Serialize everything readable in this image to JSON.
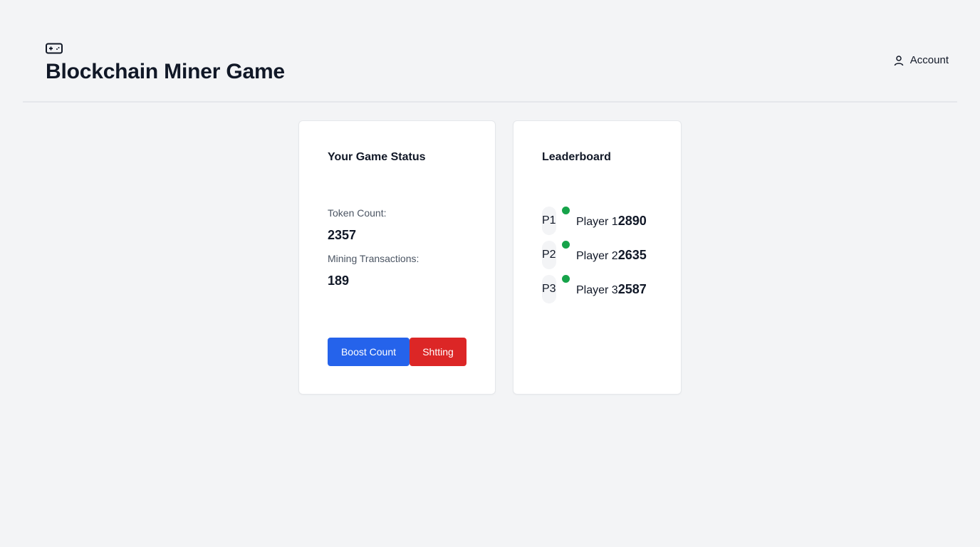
{
  "header": {
    "title": "Blockchain Miner Game",
    "logo_icon": "gamepad-icon",
    "account_label": "Account",
    "account_icon": "user-icon"
  },
  "status_card": {
    "title": "Your Game Status",
    "token_count_label": "Token Count:",
    "token_count_value": "2357",
    "mining_label": "Mining Transactions:",
    "mining_value": "189",
    "boost_button": "Boost Count",
    "shtting_button": "Shtting"
  },
  "leaderboard": {
    "title": "Leaderboard",
    "entries": [
      {
        "avatar": "P1",
        "name": "Player 1",
        "score": "2890"
      },
      {
        "avatar": "P2",
        "name": "Player 2",
        "score": "2635"
      },
      {
        "avatar": "P3",
        "name": "Player 3",
        "score": "2587"
      }
    ]
  },
  "colors": {
    "background": "#f3f4f6",
    "primary_button": "#2563eb",
    "danger_button": "#dc2626",
    "online_dot": "#16a34a"
  }
}
